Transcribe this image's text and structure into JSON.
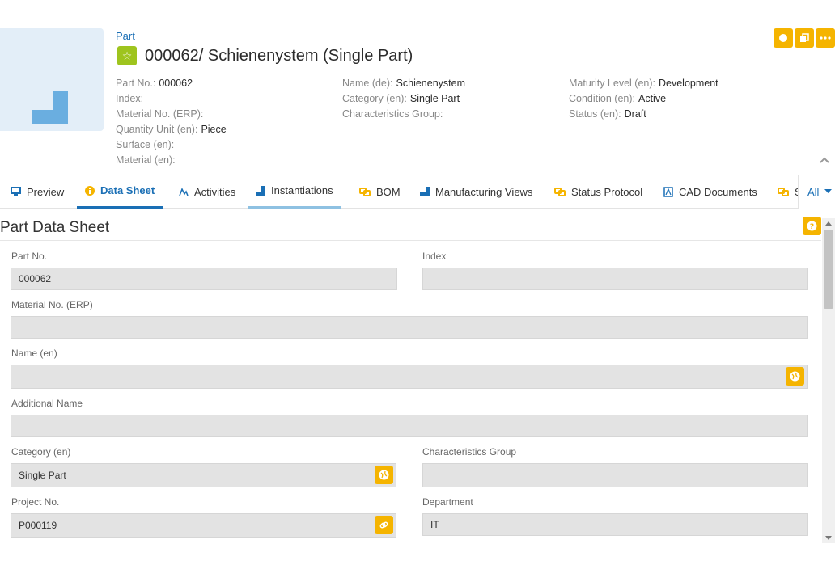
{
  "header": {
    "breadcrumb": "Part",
    "title": "000062/ Schienenystem (Single Part)",
    "attributes_col1": [
      {
        "label": "Part No.:",
        "value": "000062"
      },
      {
        "label": "Index:",
        "value": ""
      },
      {
        "label": "Material No. (ERP):",
        "value": ""
      },
      {
        "label": "Quantity Unit (en):",
        "value": "Piece"
      },
      {
        "label": "Surface (en):",
        "value": ""
      },
      {
        "label": "Material (en):",
        "value": ""
      }
    ],
    "attributes_col2": [
      {
        "label": "Name (de):",
        "value": "Schienenystem"
      },
      {
        "label": "Category (en):",
        "value": "Single Part"
      },
      {
        "label": "Characteristics Group:",
        "value": ""
      }
    ],
    "attributes_col3": [
      {
        "label": "Maturity Level (en):",
        "value": "Development"
      },
      {
        "label": "Condition (en):",
        "value": "Active"
      },
      {
        "label": "Status (en):",
        "value": "Draft"
      }
    ]
  },
  "tabs": [
    {
      "label": "Preview"
    },
    {
      "label": "Data Sheet"
    },
    {
      "label": "Activities"
    },
    {
      "label": "Instantiations"
    },
    {
      "label": "BOM"
    },
    {
      "label": "Manufacturing Views"
    },
    {
      "label": "Status Protocol"
    },
    {
      "label": "CAD Documents"
    },
    {
      "label": "S"
    }
  ],
  "tabs_more_label": "All",
  "datasheet": {
    "title": "Part Data Sheet",
    "fields": {
      "part_no": {
        "label": "Part No.",
        "value": "000062"
      },
      "index": {
        "label": "Index",
        "value": ""
      },
      "material_no": {
        "label": "Material No. (ERP)",
        "value": ""
      },
      "name_en": {
        "label": "Name (en)",
        "value": ""
      },
      "additional_name": {
        "label": "Additional Name",
        "value": ""
      },
      "category_en": {
        "label": "Category (en)",
        "value": "Single Part"
      },
      "characteristics_group": {
        "label": "Characteristics Group",
        "value": ""
      },
      "project_no": {
        "label": "Project No.",
        "value": "P000119"
      },
      "department": {
        "label": "Department",
        "value": "IT"
      }
    }
  },
  "colors": {
    "accent_blue": "#1a6fb5",
    "action_yellow": "#f5b400",
    "star_green": "#9ec41e",
    "field_bg": "#e3e3e3"
  }
}
